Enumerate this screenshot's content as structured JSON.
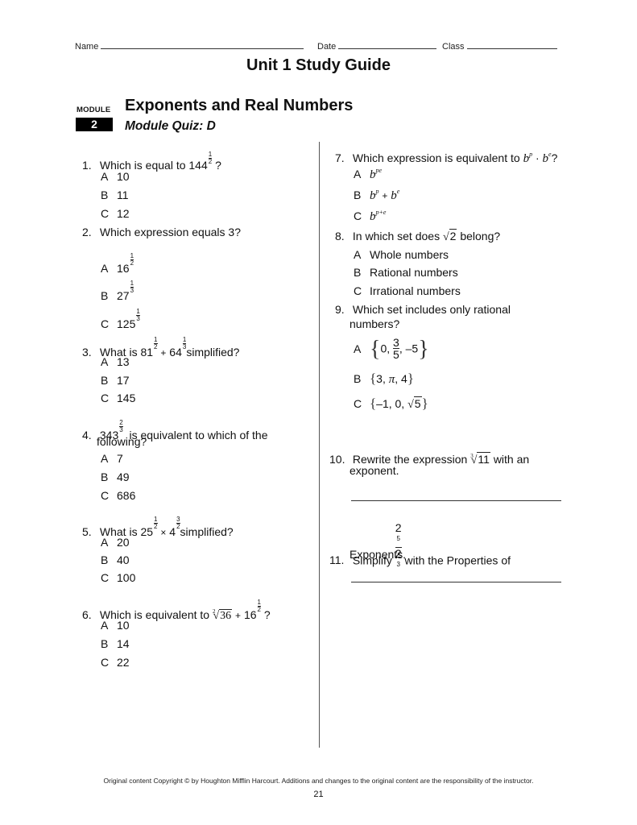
{
  "header": {
    "name_label": "Name",
    "date_label": "Date",
    "class_label": "Class"
  },
  "title": "Unit 1 Study Guide",
  "module": {
    "label": "MODULE",
    "number": "2",
    "title": "Exponents and Real Numbers",
    "subtitle": "Module Quiz: D"
  },
  "questions": [
    {
      "number": "1.",
      "text_before": "Which is equal to 144",
      "exp_num": "1",
      "exp_den": "2",
      "text_after": "?",
      "options": [
        {
          "letter": "A",
          "value": "10"
        },
        {
          "letter": "B",
          "value": "11"
        },
        {
          "letter": "C",
          "value": "12"
        }
      ]
    },
    {
      "number": "2.",
      "text": "Which expression equals 3?",
      "options": [
        {
          "letter": "A",
          "base": "16",
          "exp_num": "1",
          "exp_den": "2"
        },
        {
          "letter": "B",
          "base": "27",
          "exp_num": "1",
          "exp_den": "3"
        },
        {
          "letter": "C",
          "base": "125",
          "exp_num": "1",
          "exp_den": "3"
        }
      ]
    },
    {
      "number": "3.",
      "text_before": "What is",
      "base1": "81",
      "exp1_num": "1",
      "exp1_den": "2",
      "operator": "+",
      "base2": "64",
      "exp2_num": "1",
      "exp2_den": "3",
      "text_after": "simplified?",
      "options": [
        {
          "letter": "A",
          "value": "13"
        },
        {
          "letter": "B",
          "value": "17"
        },
        {
          "letter": "C",
          "value": "145"
        }
      ]
    },
    {
      "number": "4.",
      "base": "343",
      "exp_num": "2",
      "exp_den": "3",
      "text_line1": "is equivalent to which of the",
      "text_line2": "following?",
      "options": [
        {
          "letter": "A",
          "value": "7"
        },
        {
          "letter": "B",
          "value": "49"
        },
        {
          "letter": "C",
          "value": "686"
        }
      ]
    },
    {
      "number": "5.",
      "text_before": "What is",
      "base1": "25",
      "exp1_num": "1",
      "exp1_den": "2",
      "operator": "×",
      "base2": "4",
      "exp2_num": "3",
      "exp2_den": "2",
      "text_after": "simplified?",
      "options": [
        {
          "letter": "A",
          "value": "20"
        },
        {
          "letter": "B",
          "value": "40"
        },
        {
          "letter": "C",
          "value": "100"
        }
      ]
    },
    {
      "number": "6.",
      "text_before": "Which is equivalent to",
      "root_index": "2",
      "radicand": "36",
      "operator": "+",
      "base2": "16",
      "exp2_num": "1",
      "exp2_den": "2",
      "text_after": "?",
      "options": [
        {
          "letter": "A",
          "value": "10"
        },
        {
          "letter": "B",
          "value": "14"
        },
        {
          "letter": "C",
          "value": "22"
        }
      ]
    },
    {
      "number": "7.",
      "text_before": "Which expression is equivalent to",
      "var": "b",
      "exp1": "p",
      "dot": "·",
      "exp2": "e",
      "text_after": "?",
      "options": [
        {
          "letter": "A",
          "base": "b",
          "exp": "pe"
        },
        {
          "letter": "B",
          "base": "b",
          "exp": "p",
          "operator": "+",
          "base2": "b",
          "exp2": "e"
        },
        {
          "letter": "C",
          "base": "b",
          "exp": "p+e"
        }
      ]
    },
    {
      "number": "8.",
      "text_before": "In which set does",
      "radicand": "2",
      "text_after": "belong?",
      "options": [
        {
          "letter": "A",
          "value": "Whole numbers"
        },
        {
          "letter": "B",
          "value": "Rational numbers"
        },
        {
          "letter": "C",
          "value": "Irrational numbers"
        }
      ]
    },
    {
      "number": "9.",
      "text_line1": "Which set includes only rational",
      "text_line2": "numbers?",
      "options": [
        {
          "letter": "A",
          "item1": "0,",
          "frac_num": "3",
          "frac_den": "5",
          "item3": ", –5"
        },
        {
          "letter": "B",
          "item1": "3,",
          "item2": "π",
          "item3": ", 4"
        },
        {
          "letter": "C",
          "item1": "–1, 0,",
          "radicand": "5"
        }
      ]
    },
    {
      "number": "10.",
      "text_before": "Rewrite the expression",
      "root_index": "3",
      "radicand": "11",
      "text_after": "with an",
      "text_line2": "exponent."
    },
    {
      "number": "11.",
      "text_before": "Simplify",
      "num_base": "2",
      "num_exp": "5",
      "den_base": "2",
      "den_exp": "3",
      "text_after": "with the Properties of",
      "text_line2": "Exponents."
    }
  ],
  "footer": {
    "copyright": "Original content Copyright © by Houghton Mifflin Harcourt. Additions and changes to the original content are the responsibility of the instructor.",
    "page_number": "21"
  }
}
